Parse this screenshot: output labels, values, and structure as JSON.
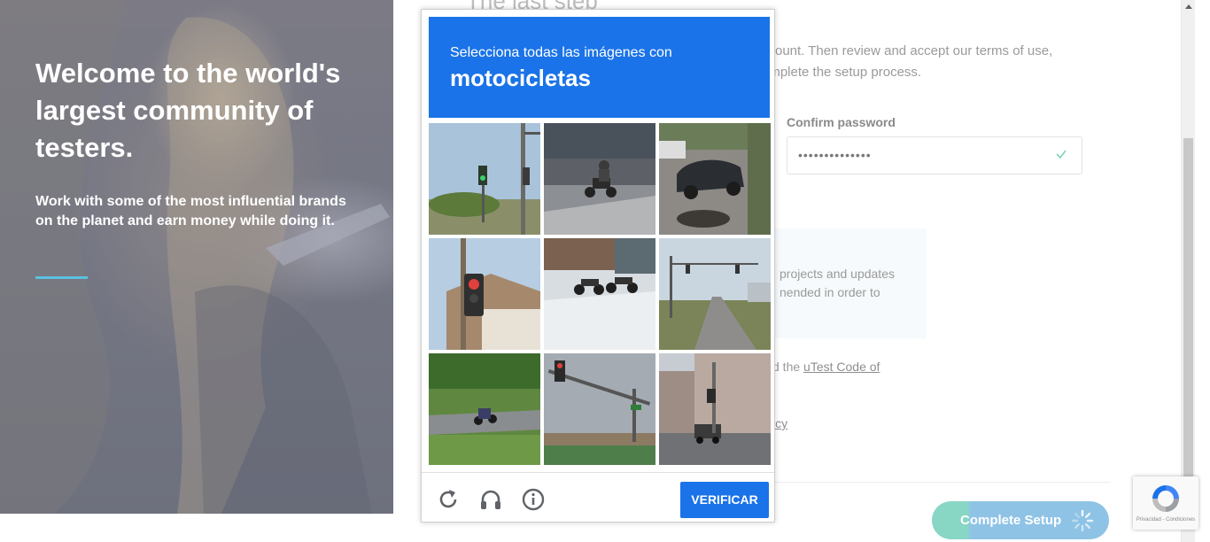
{
  "hero": {
    "title": "Welcome to the world's largest community of testers.",
    "subtitle": "Work with some of the most influential brands on the planet and earn money while doing it.",
    "accent_color": "#5bc1e0"
  },
  "form": {
    "title": "The last step",
    "intro": "ccount. Then review and accept our terms of use, omplete the setup process.",
    "confirm_password_label": "Confirm password",
    "confirm_password_value": "••••••••••••••",
    "info_text": "projects and updates nended in order to",
    "code_prefix": "d the ",
    "code_link": "uTest Code of",
    "policy_link": "icy",
    "complete_button": "Complete Setup"
  },
  "captcha": {
    "instruction": "Selecciona todas las imágenes con",
    "target": "motocicletas",
    "verify_label": "VERIFICAR",
    "accent_color": "#1a73e8",
    "icons": [
      "refresh-icon",
      "headphones-icon",
      "info-icon"
    ]
  },
  "recaptcha_badge": {
    "text": "Privacidad - Condiciones"
  }
}
